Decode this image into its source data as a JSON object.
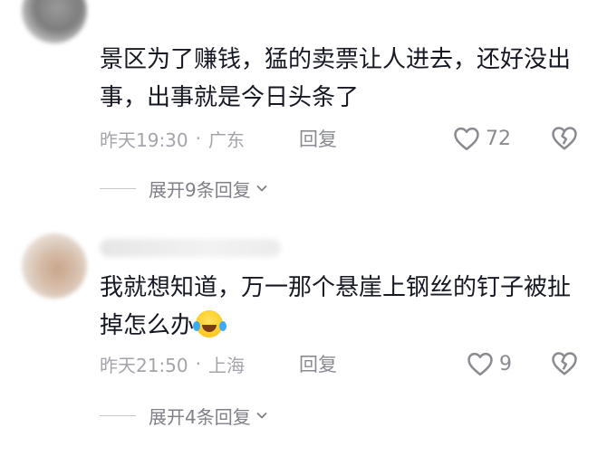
{
  "comments": [
    {
      "text": "景区为了赚钱，猛的卖票让人进去，还好没出事，出事就是今日头条了",
      "time": "昨天19:30",
      "location": "广东",
      "reply_label": "回复",
      "likes": "72",
      "expand_label": "展开9条回复"
    },
    {
      "text": "我就想知道，万一那个悬崖上钢丝的钉子被扯掉怎么办",
      "emoji": "crying-laughing-emoji",
      "time": "昨天21:50",
      "location": "上海",
      "reply_label": "回复",
      "likes": "9",
      "expand_label": "展开4条回复"
    }
  ],
  "meta_separator": "·",
  "icons": {
    "like": "heart-outline-icon",
    "dislike": "broken-heart-icon",
    "expand": "chevron-down-icon"
  },
  "colors": {
    "text": "#161823",
    "meta": "#a3a5ab",
    "action": "#8a8b91"
  }
}
